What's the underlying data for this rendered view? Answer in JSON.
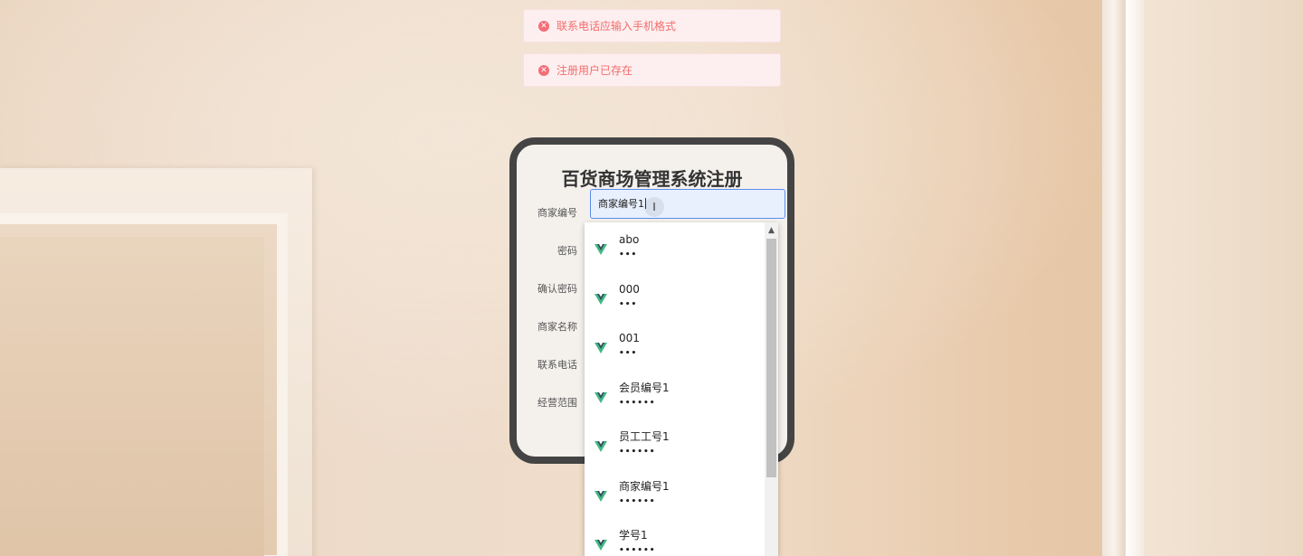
{
  "toasts": [
    {
      "message": "联系电话应输入手机格式",
      "icon": "error-circle-icon"
    },
    {
      "message": "注册用户已存在",
      "icon": "error-circle-icon"
    }
  ],
  "form": {
    "title": "百货商场管理系统注册",
    "labels": {
      "merchant_id": "商家编号",
      "password": "密码",
      "confirm_password": "确认密码",
      "merchant_name": "商家名称",
      "phone": "联系电话",
      "business_scope": "经营范围"
    },
    "merchant_id_value": "商家编号1"
  },
  "autofill": {
    "icon": "vue-logo-icon",
    "items": [
      {
        "user": "abo",
        "pass": "•••"
      },
      {
        "user": "000",
        "pass": "•••"
      },
      {
        "user": "001",
        "pass": "•••"
      },
      {
        "user": "会员编号1",
        "pass": "••••••"
      },
      {
        "user": "员工工号1",
        "pass": "••••••"
      },
      {
        "user": "商家编号1",
        "pass": "••••••"
      },
      {
        "user": "学号1",
        "pass": "••••••"
      }
    ]
  },
  "colors": {
    "error": "#f56c6c",
    "toast_bg": "#fdeff0",
    "card_border": "#444444",
    "input_focus": "#5b8def",
    "vue_green": "#41b883",
    "vue_dark": "#35495e"
  }
}
